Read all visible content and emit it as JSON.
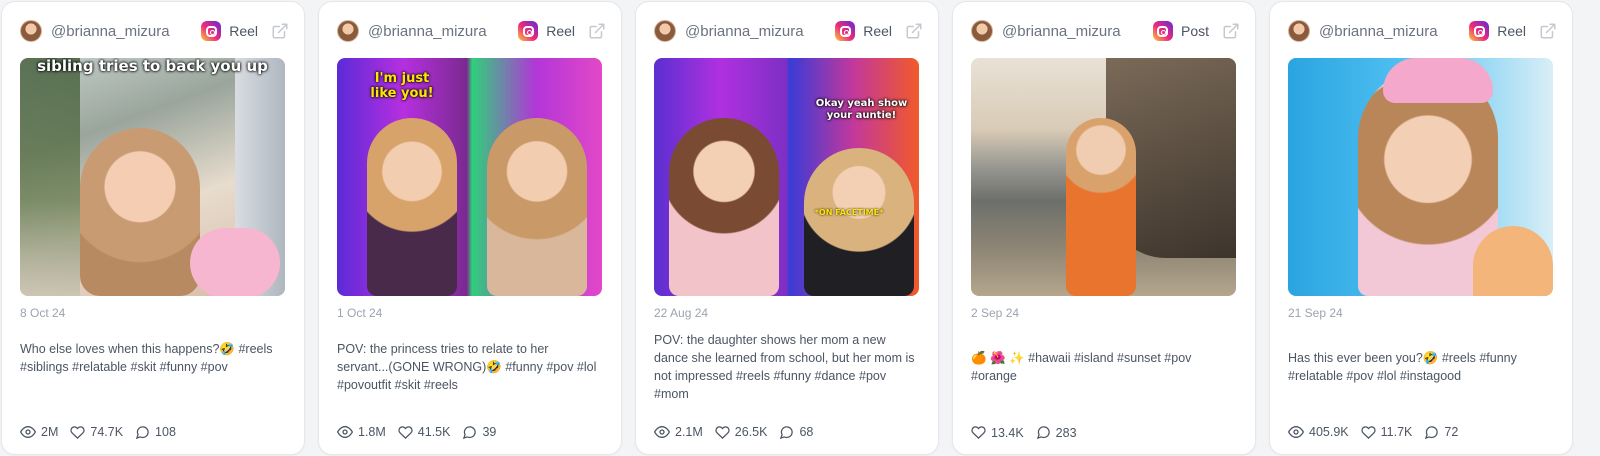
{
  "colors": {
    "card_bg": "#ffffff",
    "page_bg": "#f3f4f6",
    "text": "#4b5563",
    "muted": "#9ca3af"
  },
  "posts": [
    {
      "username": "@brianna_mizura",
      "platform_icon": "instagram-icon",
      "type": "Reel",
      "overlay_text": "sibling tries to back you up",
      "date": "8 Oct 24",
      "caption": "Who else loves when this happens?🤣 #reels #siblings #relatable #skit #funny #pov",
      "views": "2M",
      "likes": "74.7K",
      "comments": "108"
    },
    {
      "username": "@brianna_mizura",
      "platform_icon": "instagram-icon",
      "type": "Reel",
      "overlay_text": "I'm just like you!",
      "date": "1 Oct 24",
      "caption": "POV: the princess tries to relate to her servant...(GONE WRONG)🤣 #funny #pov #lol #povoutfit #skit #reels",
      "views": "1.8M",
      "likes": "41.5K",
      "comments": "39"
    },
    {
      "username": "@brianna_mizura",
      "platform_icon": "instagram-icon",
      "type": "Reel",
      "overlay_text": "Okay yeah show your auntie!",
      "overlay_text_2": "*ON FACETIME*",
      "date": "22 Aug 24",
      "caption": "POV: the daughter shows her mom a new dance she learned from school, but her mom is not impressed #reels #funny #dance #pov #mom",
      "views": "2.1M",
      "likes": "26.5K",
      "comments": "68"
    },
    {
      "username": "@brianna_mizura",
      "platform_icon": "instagram-icon",
      "type": "Post",
      "date": "2 Sep 24",
      "caption": "🍊 🌺 ✨ #hawaii #island #sunset #pov #orange",
      "likes": "13.4K",
      "comments": "283"
    },
    {
      "username": "@brianna_mizura",
      "platform_icon": "instagram-icon",
      "type": "Reel",
      "date": "21 Sep 24",
      "caption": "Has this ever been you?🤣 #reels #funny #relatable #pov #lol #instagood",
      "views": "405.9K",
      "likes": "11.7K",
      "comments": "72"
    }
  ]
}
